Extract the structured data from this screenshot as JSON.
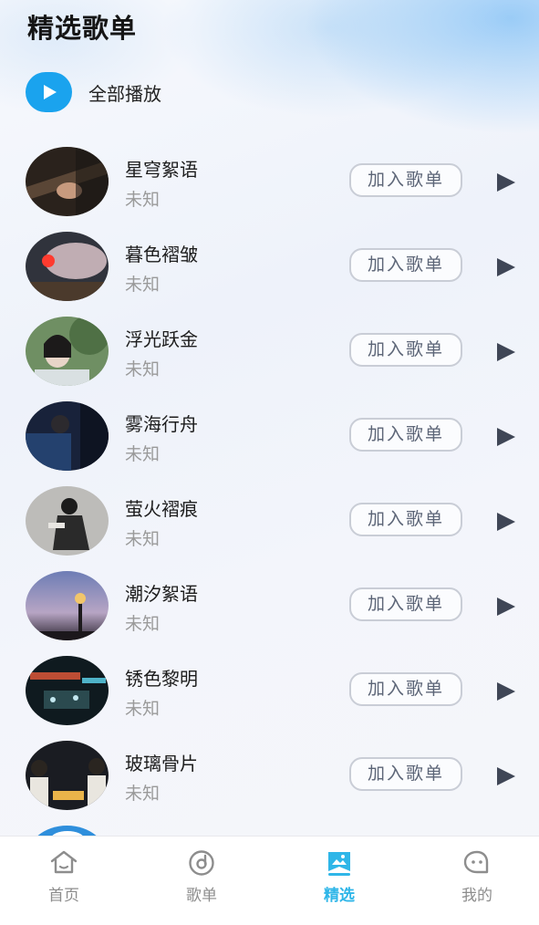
{
  "header": {
    "title": "精选歌单"
  },
  "play_all": {
    "label": "全部播放",
    "icon": "play-icon",
    "color": "#1aa3ee"
  },
  "songs": [
    {
      "title": "星穹絮语",
      "artist": "未知",
      "add_label": "加入歌单"
    },
    {
      "title": "暮色褶皱",
      "artist": "未知",
      "add_label": "加入歌单"
    },
    {
      "title": "浮光跃金",
      "artist": "未知",
      "add_label": "加入歌单"
    },
    {
      "title": "雾海行舟",
      "artist": "未知",
      "add_label": "加入歌单"
    },
    {
      "title": "萤火褶痕",
      "artist": "未知",
      "add_label": "加入歌单"
    },
    {
      "title": "潮汐絮语",
      "artist": "未知",
      "add_label": "加入歌单"
    },
    {
      "title": "锈色黎明",
      "artist": "未知",
      "add_label": "加入歌单"
    },
    {
      "title": "玻璃骨片",
      "artist": "未知",
      "add_label": "加入歌单"
    }
  ],
  "tabbar": {
    "items": [
      {
        "label": "首页",
        "icon": "home-icon",
        "active": false
      },
      {
        "label": "歌单",
        "icon": "disc-icon",
        "active": false
      },
      {
        "label": "精选",
        "icon": "bookmark-picture-icon",
        "active": true
      },
      {
        "label": "我的",
        "icon": "chat-face-icon",
        "active": false
      }
    ],
    "active_color": "#2fb6e8",
    "inactive_color": "#8d8d8d"
  }
}
